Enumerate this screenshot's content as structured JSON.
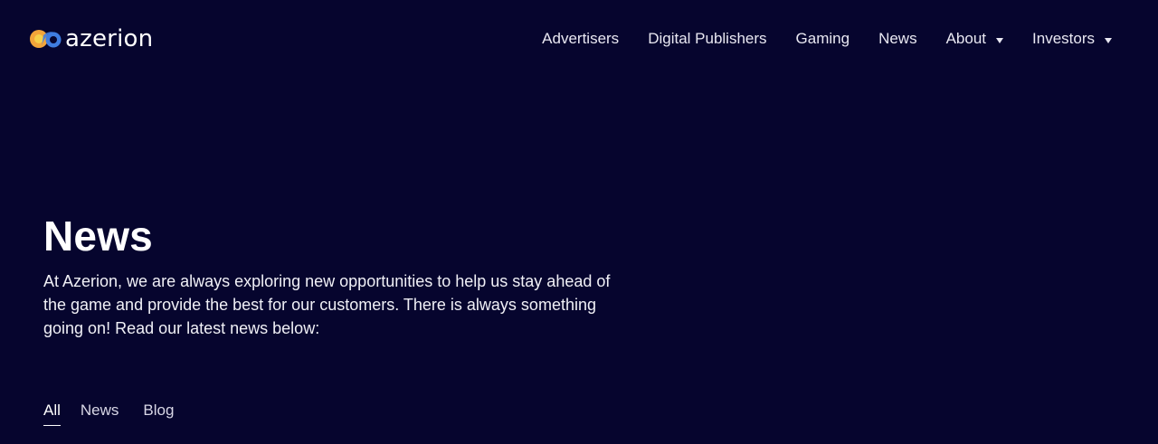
{
  "brand": {
    "name": "azerion",
    "colors": {
      "background": "#06052e",
      "logo_blue": "#3f7de0",
      "logo_orange": "#f2a53a",
      "logo_yellow": "#f5d04a"
    }
  },
  "nav": {
    "items": [
      {
        "label": "Advertisers",
        "has_dropdown": false
      },
      {
        "label": "Digital Publishers",
        "has_dropdown": false
      },
      {
        "label": "Gaming",
        "has_dropdown": false
      },
      {
        "label": "News",
        "has_dropdown": false
      },
      {
        "label": "About",
        "has_dropdown": true
      },
      {
        "label": "Investors",
        "has_dropdown": true
      }
    ],
    "dropdown_icon": "caret-down-icon"
  },
  "hero": {
    "title": "News",
    "intro": "At Azerion, we are always exploring new opportunities to help us stay ahead of the game and provide the best for our customers. There is always something going on! Read our latest news below:"
  },
  "filters": {
    "tabs": [
      {
        "label": "All",
        "active": true
      },
      {
        "label": "News",
        "active": false
      },
      {
        "label": "Blog",
        "active": false
      }
    ]
  }
}
